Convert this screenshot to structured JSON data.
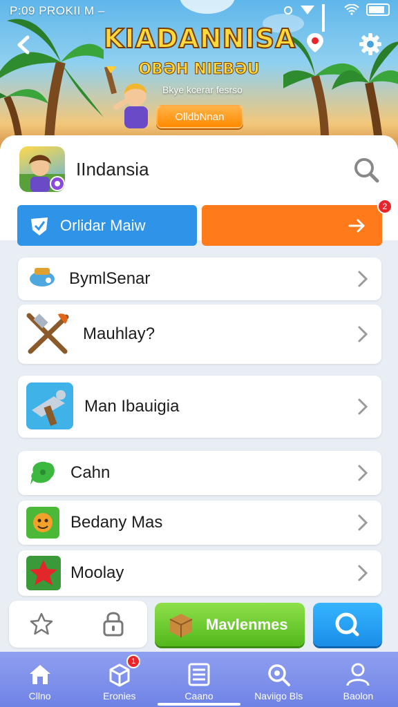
{
  "status_bar": {
    "time": "P:09 PROKII M –"
  },
  "header": {
    "game_title": "KIADANNISA",
    "game_subtitle": "OBƏH NIEBƏU",
    "tagline": "Bkye kcerar fesrso",
    "cta_label": "OlldbNnan"
  },
  "app": {
    "name": "IIndansia",
    "primary_button_label": "Orlidar Maiw",
    "notification_count": "2"
  },
  "menu": {
    "items": [
      {
        "label": "BymlSenar",
        "icon": "sub-icon"
      },
      {
        "label": "Mauhlay?",
        "icon": "weapons-icon"
      },
      {
        "label": "Man Ibauigia",
        "icon": "crafting-icon"
      },
      {
        "label": "Cahn",
        "icon": "chat-icon"
      },
      {
        "label": "Bedany Mas",
        "icon": "character-icon"
      },
      {
        "label": "Moolay",
        "icon": "star-icon"
      }
    ]
  },
  "actions": {
    "green_button_label": "Mavlenmes"
  },
  "tabbar": {
    "tabs": [
      {
        "label": "Cllno",
        "icon": "home-icon"
      },
      {
        "label": "Eronies",
        "icon": "box-icon",
        "badge": "1"
      },
      {
        "label": "Caano",
        "icon": "list-icon"
      },
      {
        "label": "Naviigo Bls",
        "icon": "search-icon"
      },
      {
        "label": "Baolon",
        "icon": "profile-icon"
      }
    ]
  },
  "colors": {
    "primary_blue": "#2f93e8",
    "orange": "#ff7a1a",
    "green": "#52b81c",
    "tabbar": "#7d8fea",
    "badge_red": "#e8262a"
  }
}
